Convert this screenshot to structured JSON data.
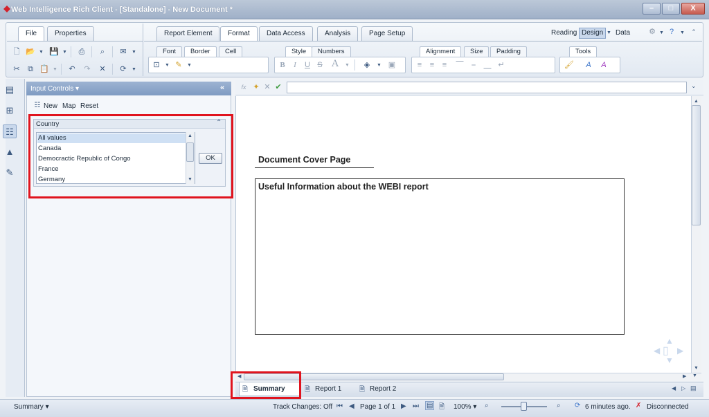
{
  "window": {
    "title": "Web Intelligence Rich Client - [Standalone] - New Document *",
    "controls": {
      "minimize": "–",
      "maximize": "□",
      "close": "X"
    }
  },
  "ribbon": {
    "left_tabs": [
      "File",
      "Properties"
    ],
    "main_tabs": [
      "Report Element",
      "Format",
      "Data Access",
      "Analysis",
      "Page Setup"
    ],
    "active_main_tab": "Format",
    "view_modes": {
      "reading": "Reading",
      "design": "Design",
      "data": "Data"
    },
    "format_subtabs": {
      "group1": [
        "Font",
        "Border",
        "Cell"
      ],
      "group2": [
        "Style",
        "Numbers"
      ],
      "group3": [
        "Alignment",
        "Size",
        "Padding"
      ],
      "group4": [
        "Tools"
      ]
    },
    "active_subtabs": [
      "Border",
      "Style",
      "Alignment",
      "Tools"
    ]
  },
  "input_controls": {
    "title": "Input Controls",
    "actions": {
      "new": "New",
      "map": "Map",
      "reset": "Reset"
    },
    "control": {
      "label": "Country",
      "items": [
        "All values",
        "Canada",
        "Democractic Republic of Congo",
        "France",
        "Germany"
      ],
      "selected": "All values",
      "ok_label": "OK"
    }
  },
  "report": {
    "cover_title": "Document Cover Page",
    "info_text": "Useful Information about the WEBI report",
    "tabs": [
      "Summary",
      "Report 1",
      "Report 2"
    ],
    "active_tab": "Summary"
  },
  "statusbar": {
    "left": "Summary",
    "track_changes": "Track Changes: Off",
    "page": "Page 1 of 1",
    "zoom": "100%",
    "refresh": "6 minutes ago.",
    "connection": "Disconnected"
  },
  "colors": {
    "accent": "#e0141e",
    "panel_header": "#7f9bc2",
    "background": "#f0f3f7"
  }
}
